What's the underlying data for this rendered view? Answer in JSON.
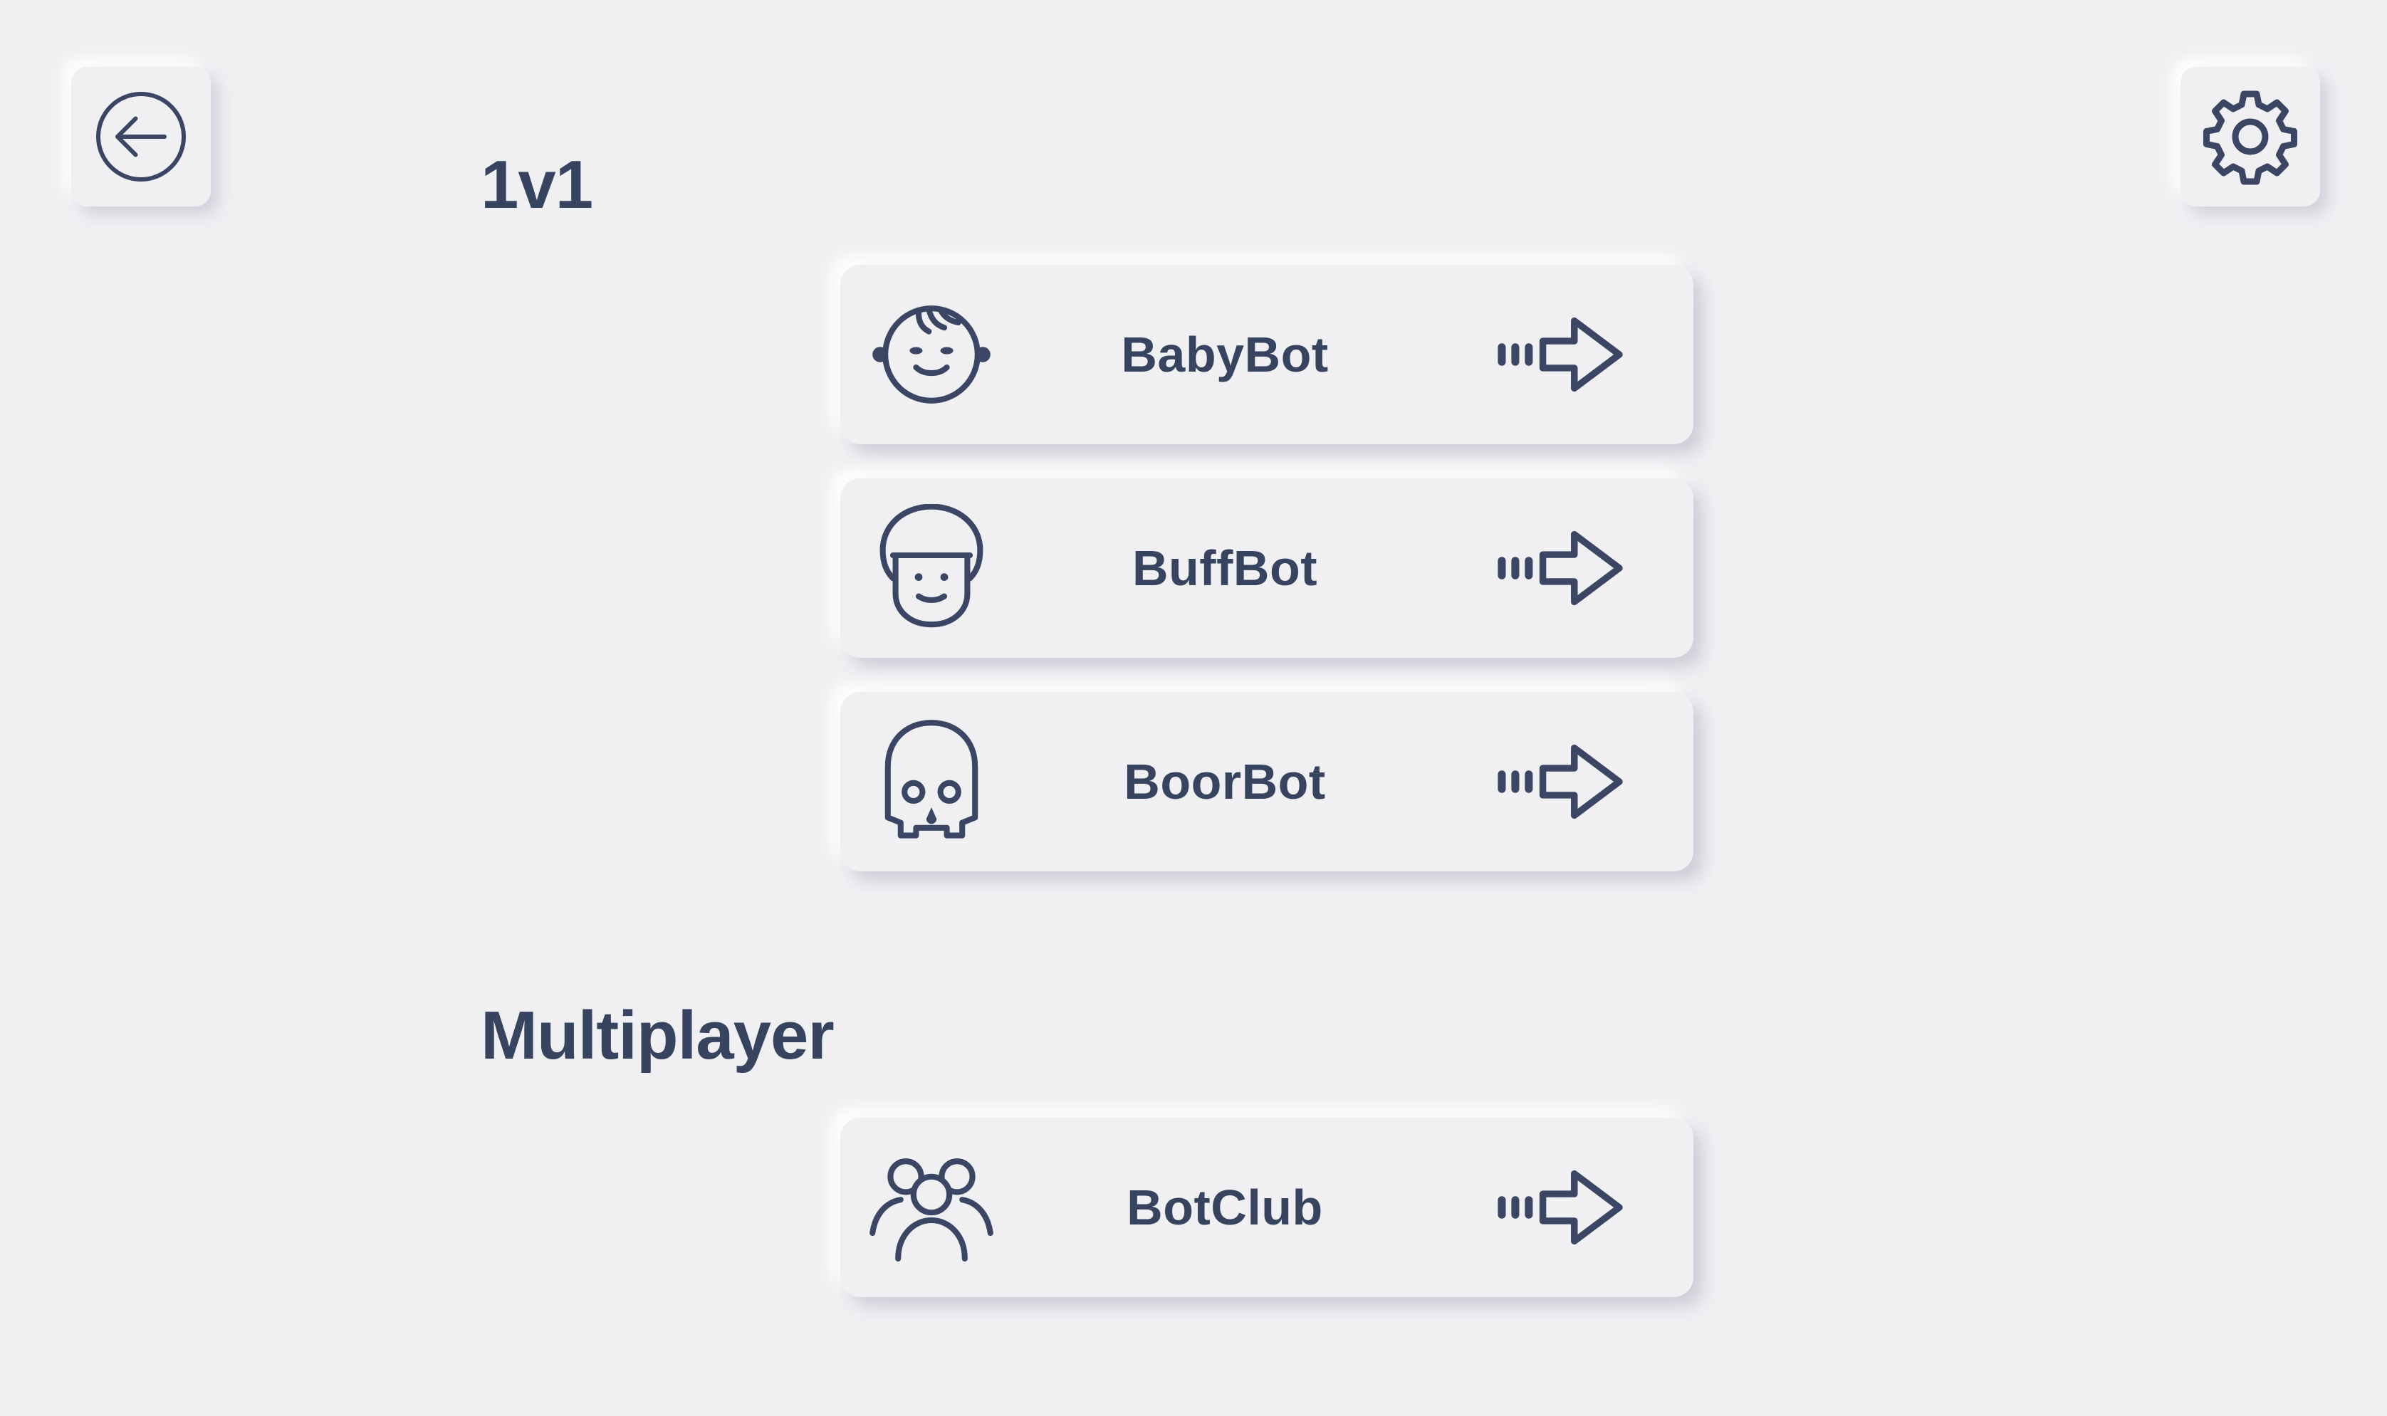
{
  "header": {
    "back_icon": "arrow-left-circle-icon",
    "settings_icon": "gear-icon"
  },
  "sections": [
    {
      "title": "1v1",
      "items": [
        {
          "label": "BabyBot",
          "icon": "baby-face-icon",
          "action_icon": "arrow-right-icon"
        },
        {
          "label": "BuffBot",
          "icon": "helmet-face-icon",
          "action_icon": "arrow-right-icon"
        },
        {
          "label": "BoorBot",
          "icon": "skull-icon",
          "action_icon": "arrow-right-icon"
        }
      ]
    },
    {
      "title": "Multiplayer",
      "items": [
        {
          "label": "BotClub",
          "icon": "group-icon",
          "action_icon": "arrow-right-icon"
        }
      ]
    }
  ],
  "colors": {
    "background": "#f0f0f3",
    "text": "#37445f",
    "icon": "#3a4664"
  }
}
